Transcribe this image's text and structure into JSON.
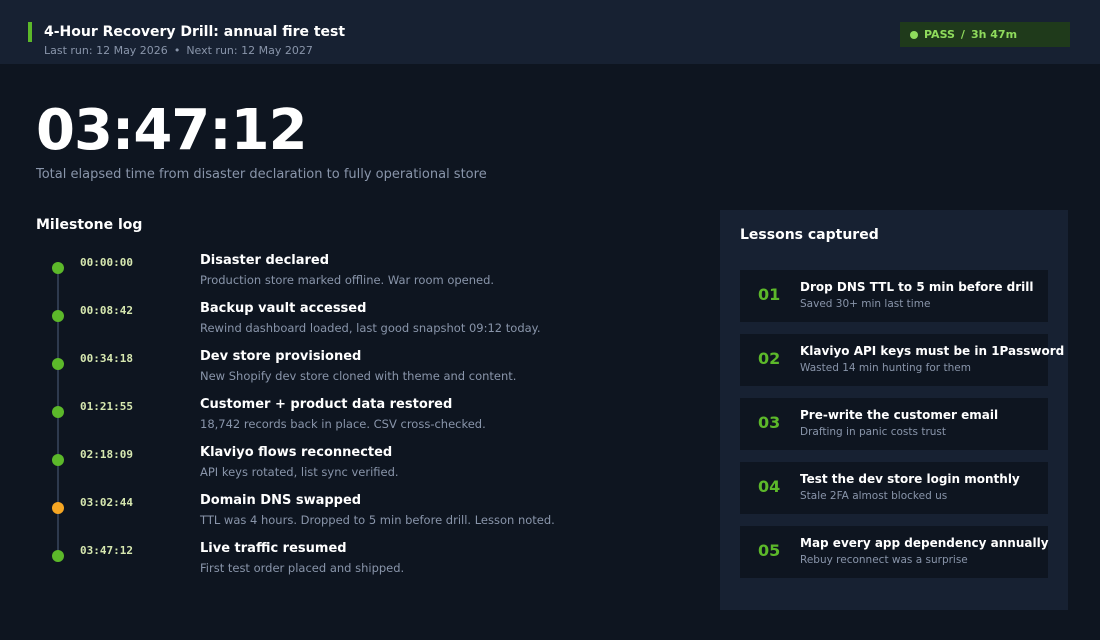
{
  "header": {
    "title": "4-Hour Recovery Drill: annual fire test",
    "last_run": "Last run: 12 May 2026",
    "separator": "•",
    "next_run": "Next run: 12 May 2027",
    "status": "PASS",
    "status_sep": "/",
    "status_duration": "3h 47m",
    "accent_color": "#5cb82a"
  },
  "timer": {
    "value": "03:47:12",
    "caption": "Total elapsed time from disaster declaration to fully operational store"
  },
  "milestone_log": {
    "title": "Milestone log",
    "items": [
      {
        "time": "00:00:00",
        "title": "Disaster declared",
        "desc": "Production store marked offline. War room opened.",
        "status": "ok"
      },
      {
        "time": "00:08:42",
        "title": "Backup vault accessed",
        "desc": "Rewind dashboard loaded, last good snapshot 09:12 today.",
        "status": "ok"
      },
      {
        "time": "00:34:18",
        "title": "Dev store provisioned",
        "desc": "New Shopify dev store cloned with theme and content.",
        "status": "ok"
      },
      {
        "time": "01:21:55",
        "title": "Customer + product data restored",
        "desc": "18,742 records back in place. CSV cross-checked.",
        "status": "ok"
      },
      {
        "time": "02:18:09",
        "title": "Klaviyo flows reconnected",
        "desc": "API keys rotated, list sync verified.",
        "status": "ok"
      },
      {
        "time": "03:02:44",
        "title": "Domain DNS swapped",
        "desc": "TTL was 4 hours. Dropped to 5 min before drill. Lesson noted.",
        "status": "warn"
      },
      {
        "time": "03:47:12",
        "title": "Live traffic resumed",
        "desc": "First test order placed and shipped.",
        "status": "ok"
      }
    ]
  },
  "lessons": {
    "title": "Lessons captured",
    "items": [
      {
        "num": "01",
        "title": "Drop DNS TTL to 5 min before drill",
        "desc": "Saved 30+ min last time"
      },
      {
        "num": "02",
        "title": "Klaviyo API keys must be in 1Password",
        "desc": "Wasted 14 min hunting for them"
      },
      {
        "num": "03",
        "title": "Pre-write the customer email",
        "desc": "Drafting in panic costs trust"
      },
      {
        "num": "04",
        "title": "Test the dev store login monthly",
        "desc": "Stale 2FA almost blocked us"
      },
      {
        "num": "05",
        "title": "Map every app dependency annually",
        "desc": "Rebuy reconnect was a surprise"
      }
    ]
  },
  "colors": {
    "background": "#0e1520",
    "panel": "#172132",
    "ok": "#5cb82a",
    "warn": "#f5a623",
    "muted_text": "#8995aa"
  }
}
